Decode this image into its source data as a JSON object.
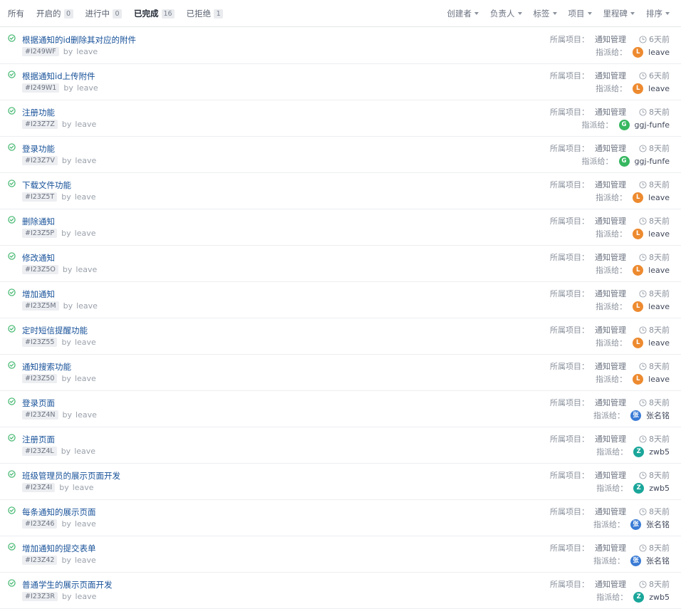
{
  "tabs": [
    {
      "label": "所有",
      "count": null
    },
    {
      "label": "开启的",
      "count": "0"
    },
    {
      "label": "进行中",
      "count": "0"
    },
    {
      "label": "已完成",
      "count": "16",
      "active": true
    },
    {
      "label": "已拒绝",
      "count": "1"
    }
  ],
  "filters": [
    "创建者",
    "负责人",
    "标签",
    "项目",
    "里程碑",
    "排序"
  ],
  "labels": {
    "project": "所属项目：",
    "assign": "指派给：",
    "by": "by"
  },
  "colors": {
    "status": "#3cb56a",
    "orange": "#ed8a2f",
    "green": "#36b760",
    "blue": "#3a7bd5",
    "teal": "#1aa69a"
  },
  "issues": [
    {
      "title": "根据通知的id删除其对应的附件",
      "ident": "#I249WF",
      "author": "leave",
      "project": "通知管理",
      "time": "6天前",
      "assignee": "leave",
      "avatar_text": "L",
      "avatar_color": "#ed8a2f"
    },
    {
      "title": "根据通知id上传附件",
      "ident": "#I249W1",
      "author": "leave",
      "project": "通知管理",
      "time": "6天前",
      "assignee": "leave",
      "avatar_text": "L",
      "avatar_color": "#ed8a2f"
    },
    {
      "title": "注册功能",
      "ident": "#I23Z7Z",
      "author": "leave",
      "project": "通知管理",
      "time": "8天前",
      "assignee": "ggj-funfe",
      "avatar_text": "G",
      "avatar_color": "#36b760"
    },
    {
      "title": "登录功能",
      "ident": "#I23Z7V",
      "author": "leave",
      "project": "通知管理",
      "time": "8天前",
      "assignee": "ggj-funfe",
      "avatar_text": "G",
      "avatar_color": "#36b760"
    },
    {
      "title": "下载文件功能",
      "ident": "#I23Z5T",
      "author": "leave",
      "project": "通知管理",
      "time": "8天前",
      "assignee": "leave",
      "avatar_text": "L",
      "avatar_color": "#ed8a2f"
    },
    {
      "title": "删除通知",
      "ident": "#I23Z5P",
      "author": "leave",
      "project": "通知管理",
      "time": "8天前",
      "assignee": "leave",
      "avatar_text": "L",
      "avatar_color": "#ed8a2f"
    },
    {
      "title": "修改通知",
      "ident": "#I23Z5O",
      "author": "leave",
      "project": "通知管理",
      "time": "8天前",
      "assignee": "leave",
      "avatar_text": "L",
      "avatar_color": "#ed8a2f"
    },
    {
      "title": "增加通知",
      "ident": "#I23Z5M",
      "author": "leave",
      "project": "通知管理",
      "time": "8天前",
      "assignee": "leave",
      "avatar_text": "L",
      "avatar_color": "#ed8a2f"
    },
    {
      "title": "定时短信提醒功能",
      "ident": "#I23Z55",
      "author": "leave",
      "project": "通知管理",
      "time": "8天前",
      "assignee": "leave",
      "avatar_text": "L",
      "avatar_color": "#ed8a2f"
    },
    {
      "title": "通知搜索功能",
      "ident": "#I23Z50",
      "author": "leave",
      "project": "通知管理",
      "time": "8天前",
      "assignee": "leave",
      "avatar_text": "L",
      "avatar_color": "#ed8a2f"
    },
    {
      "title": "登录页面",
      "ident": "#I23Z4N",
      "author": "leave",
      "project": "通知管理",
      "time": "8天前",
      "assignee": "张名铭",
      "avatar_text": "张",
      "avatar_color": "#3a7bd5"
    },
    {
      "title": "注册页面",
      "ident": "#I23Z4L",
      "author": "leave",
      "project": "通知管理",
      "time": "8天前",
      "assignee": "zwb5",
      "avatar_text": "Z",
      "avatar_color": "#1aa69a"
    },
    {
      "title": "班级管理员的展示页面开发",
      "ident": "#I23Z4I",
      "author": "leave",
      "project": "通知管理",
      "time": "8天前",
      "assignee": "zwb5",
      "avatar_text": "Z",
      "avatar_color": "#1aa69a"
    },
    {
      "title": "每条通知的展示页面",
      "ident": "#I23Z46",
      "author": "leave",
      "project": "通知管理",
      "time": "8天前",
      "assignee": "张名铭",
      "avatar_text": "张",
      "avatar_color": "#3a7bd5"
    },
    {
      "title": "增加通知的提交表单",
      "ident": "#I23Z42",
      "author": "leave",
      "project": "通知管理",
      "time": "8天前",
      "assignee": "张名铭",
      "avatar_text": "张",
      "avatar_color": "#3a7bd5"
    },
    {
      "title": "普通学生的展示页面开发",
      "ident": "#I23Z3R",
      "author": "leave",
      "project": "通知管理",
      "time": "8天前",
      "assignee": "zwb5",
      "avatar_text": "Z",
      "avatar_color": "#1aa69a"
    }
  ]
}
